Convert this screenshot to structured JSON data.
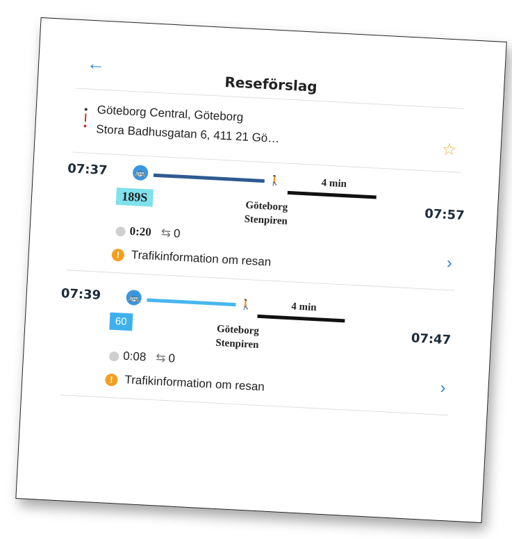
{
  "header": {
    "back_icon": "arrow-left-icon",
    "title": "Reseförslag"
  },
  "route": {
    "from": "Göteborg Central, Göteborg",
    "to": "Stora Badhusgatan 6, 411 21 Gö…",
    "favorite_icon": "star-outline-icon"
  },
  "trips": [
    {
      "departure": "07:37",
      "arrival": "07:57",
      "line": "189S",
      "line_color": "#7fe1ec",
      "walk_time": "4 min",
      "stop_line1": "Göteborg",
      "stop_line2": "Stenpiren",
      "duration": "0:20",
      "changes": "0",
      "info": "Trafikinformation om resan",
      "bar_color": "#2e5a90"
    },
    {
      "departure": "07:39",
      "arrival": "07:47",
      "line": "60",
      "line_color": "#3fb0ee",
      "walk_time": "4 min",
      "stop_line1": "Göteborg",
      "stop_line2": "Stenpiren",
      "duration": "0:08",
      "changes": "0",
      "info": "Trafikinformation om resan",
      "bar_color": "#48b6ee"
    }
  ]
}
